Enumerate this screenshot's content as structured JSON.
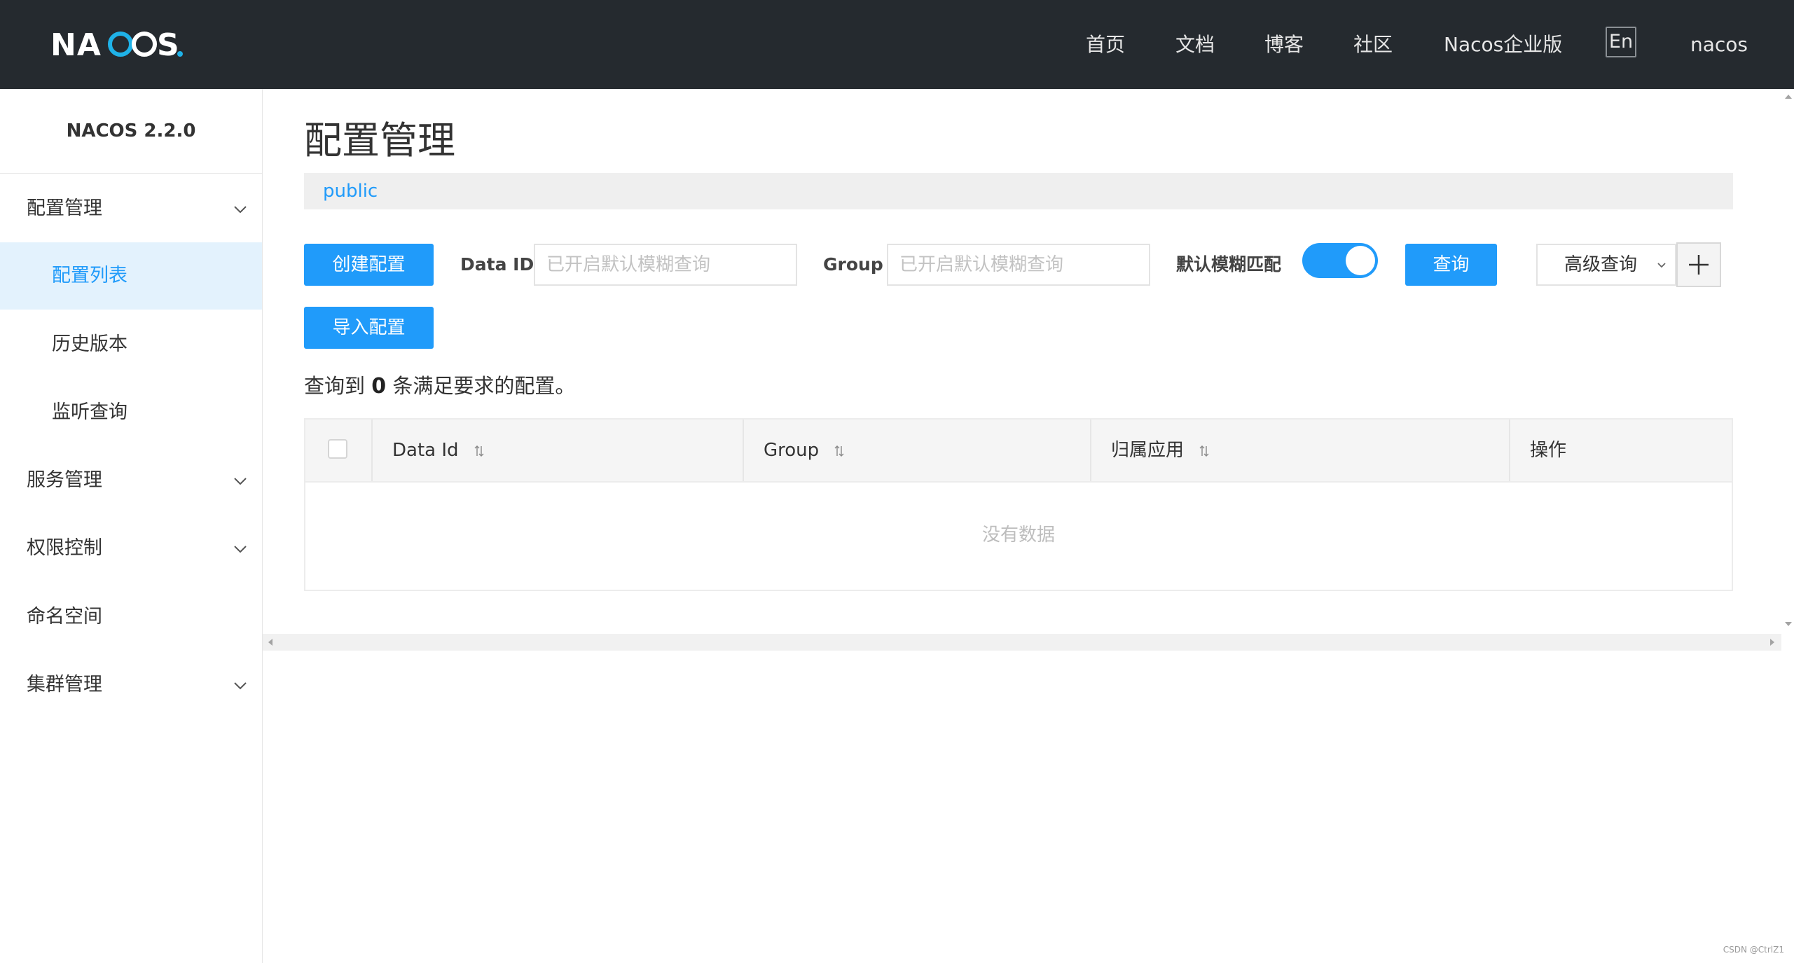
{
  "header": {
    "logo_text": "NACOS.",
    "nav": [
      "首页",
      "文档",
      "博客",
      "社区",
      "Nacos企业版"
    ],
    "lang_button": "En",
    "user": "nacos"
  },
  "sidebar": {
    "version": "NACOS 2.2.0",
    "items": [
      {
        "label": "配置管理",
        "type": "group",
        "expanded": true
      },
      {
        "label": "配置列表",
        "type": "sub",
        "active": true
      },
      {
        "label": "历史版本",
        "type": "sub"
      },
      {
        "label": "监听查询",
        "type": "sub"
      },
      {
        "label": "服务管理",
        "type": "group"
      },
      {
        "label": "权限控制",
        "type": "group"
      },
      {
        "label": "命名空间",
        "type": "leaf"
      },
      {
        "label": "集群管理",
        "type": "group"
      }
    ]
  },
  "main": {
    "title": "配置管理",
    "namespace": "public",
    "toolbar": {
      "create_label": "创建配置",
      "import_label": "导入配置",
      "data_id_label": "Data ID",
      "data_id_placeholder": "已开启默认模糊查询",
      "group_label": "Group",
      "group_placeholder": "已开启默认模糊查询",
      "fuzzy_label": "默认模糊匹配",
      "fuzzy_on": true,
      "query_label": "查询",
      "advanced_label": "高级查询"
    },
    "result": {
      "prefix": "查询到",
      "count": "0",
      "suffix": "条满足要求的配置。"
    },
    "table": {
      "columns": [
        "Data Id",
        "Group",
        "归属应用",
        "操作"
      ],
      "empty_text": "没有数据"
    }
  },
  "watermark": "CSDN @CtrlZ1",
  "colors": {
    "accent": "#209bfa",
    "topbar": "#252a2f",
    "active_bg": "#e3f2fd"
  }
}
